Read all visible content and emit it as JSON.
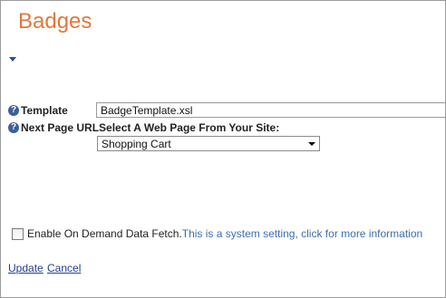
{
  "page": {
    "title": "Badges"
  },
  "form": {
    "template": {
      "label": "Template",
      "value": "BadgeTemplate.xsl"
    },
    "next_page_url": {
      "label": "Next Page URL",
      "select_prompt": "Select A Web Page From Your Site:",
      "selected": "Shopping Cart"
    },
    "on_demand": {
      "label": "Enable On Demand Data Fetch.",
      "info_link": "This is a system setting, click for more information",
      "checked": false
    }
  },
  "actions": {
    "update": "Update",
    "cancel": "Cancel"
  },
  "icons": {
    "help": "help-icon",
    "collapse": "chevron-down-icon"
  },
  "colors": {
    "title": "#e0783c",
    "link": "#3b6fb0",
    "accent": "#3c5f9a"
  }
}
